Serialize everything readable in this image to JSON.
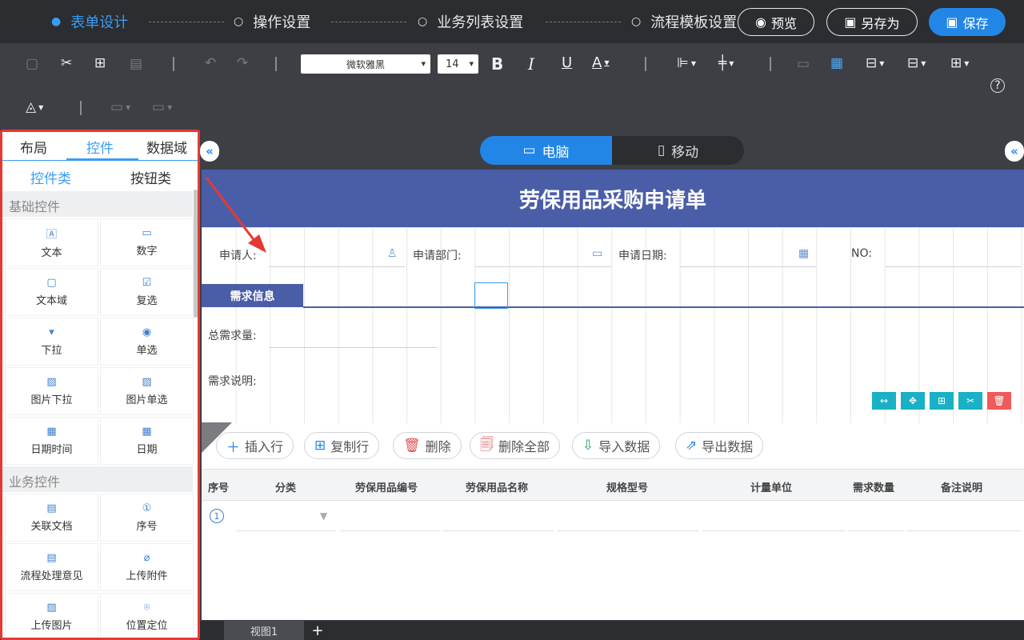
{
  "steps": [
    {
      "label": "表单设计",
      "active": true
    },
    {
      "label": "操作设置",
      "active": false
    },
    {
      "label": "业务列表设置",
      "active": false
    },
    {
      "label": "流程模板设置",
      "active": false
    }
  ],
  "top_actions": {
    "preview": "预览",
    "save_as": "另存为",
    "save": "保存"
  },
  "toolbar": {
    "font": "微软雅黑",
    "size": "14"
  },
  "left_panel": {
    "tabs": [
      "布局",
      "控件",
      "数据域"
    ],
    "subtabs": [
      "控件类",
      "按钮类"
    ],
    "basic_title": "基础控件",
    "basic": [
      "文本",
      "数字",
      "文本域",
      "复选",
      "下拉",
      "单选",
      "图片下拉",
      "图片单选",
      "日期时间",
      "日期"
    ],
    "biz_title": "业务控件",
    "biz": [
      "关联文档",
      "序号",
      "流程处理意见",
      "上传附件",
      "上传图片",
      "位置定位"
    ]
  },
  "device": {
    "pc": "电脑",
    "mobile": "移动"
  },
  "form": {
    "title": "劳保用品采购申请单",
    "applicant": "申请人:",
    "dept": "申请部门:",
    "date": "申请日期:",
    "no": "NO:",
    "section": "需求信息",
    "total": "总需求量:",
    "desc": "需求说明:"
  },
  "grid_buttons": [
    "插入行",
    "复制行",
    "删除",
    "删除全部",
    "导入数据",
    "导出数据"
  ],
  "table": {
    "headers": [
      "序号",
      "分类",
      "劳保用品编号",
      "劳保用品名称",
      "规格型号",
      "计量单位",
      "需求数量",
      "备注说明"
    ],
    "row_index": "1"
  },
  "bottom": {
    "view": "视图1",
    "add": "+"
  },
  "colors": {
    "accent": "#2286e6",
    "form_header": "#4a5ea8",
    "highlight": "#e53935"
  }
}
